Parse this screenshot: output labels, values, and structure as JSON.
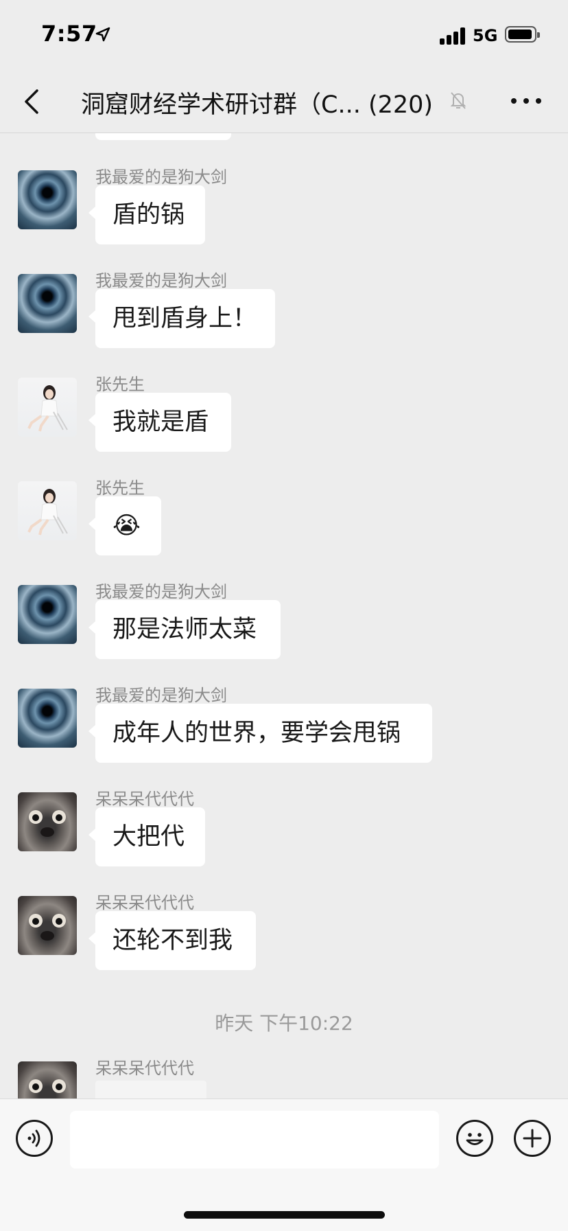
{
  "status_bar": {
    "time": "7:57",
    "network": "5G",
    "icons": [
      "location-arrow-icon",
      "signal-icon",
      "battery-icon"
    ]
  },
  "nav": {
    "title": "洞窟财经学术研讨群（C... (220)",
    "back_icon": "chevron-left-icon",
    "mute_icon": "bell-off-icon",
    "more_icon": "ellipsis-icon"
  },
  "messages": [
    {
      "sender": "我最爱的是狗大剑",
      "text": "盾的锅",
      "avatar": "vortex-avatar"
    },
    {
      "sender": "我最爱的是狗大剑",
      "text": "甩到盾身上！",
      "avatar": "vortex-avatar"
    },
    {
      "sender": "张先生",
      "text": "我就是盾",
      "avatar": "girl-avatar"
    },
    {
      "sender": "张先生",
      "text": "😭",
      "avatar": "girl-avatar"
    },
    {
      "sender": "我最爱的是狗大剑",
      "text": "那是法师太菜",
      "avatar": "vortex-avatar"
    },
    {
      "sender": "我最爱的是狗大剑",
      "text": "成年人的世界，要学会甩锅",
      "avatar": "vortex-avatar"
    },
    {
      "sender": "呆呆呆代代代",
      "text": "大把代",
      "avatar": "cat-avatar"
    },
    {
      "sender": "呆呆呆代代代",
      "text": "还轮不到我",
      "avatar": "cat-avatar"
    }
  ],
  "timestamp": "昨天 下午10:22",
  "last_message": {
    "sender": "呆呆呆代代代",
    "avatar": "cat-avatar"
  },
  "input_bar": {
    "voice_icon": "voice-icon",
    "emoji_icon": "emoji-icon",
    "plus_icon": "plus-icon",
    "input_value": ""
  },
  "colors": {
    "background": "#ededed",
    "bubble": "#ffffff",
    "sender_name": "#8a8a8a"
  }
}
